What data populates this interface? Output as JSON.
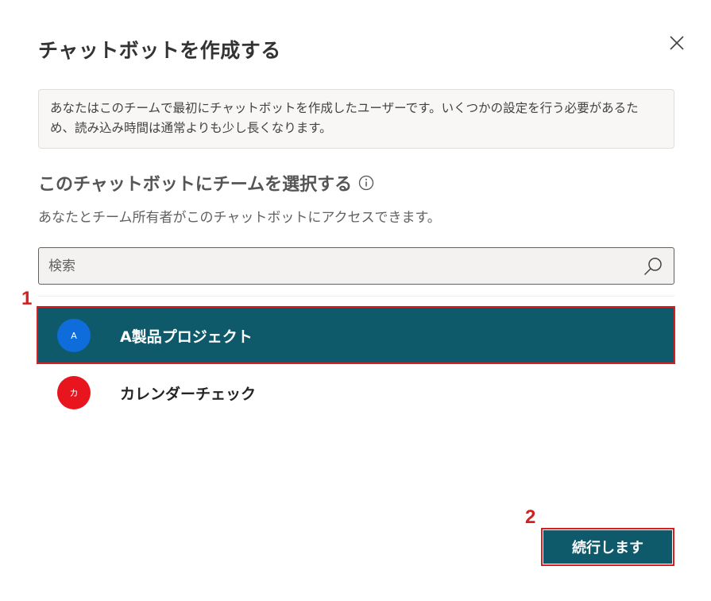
{
  "dialog": {
    "title": "チャットボットを作成する",
    "notice": "あなたはこのチームで最初にチャットボットを作成したユーザーです。いくつかの設定を行う必要があるため、読み込み時間は通常よりも少し長くなります。",
    "section_title": "このチャットボットにチームを選択する",
    "subtitle": "あなたとチーム所有者がこのチャットボットにアクセスできます。",
    "search": {
      "placeholder": "検索",
      "value": ""
    },
    "teams": [
      {
        "label": "A製品プロジェクト",
        "initial": "A",
        "color": "#0f6cdb",
        "selected": true
      },
      {
        "label": "カレンダーチェック",
        "initial": "カ",
        "color": "#e8141e",
        "selected": false
      }
    ],
    "continue_label": "続行します"
  },
  "annotations": {
    "step1": "1",
    "step2": "2",
    "color": "#d42020"
  },
  "icons": [
    "close-icon",
    "info-icon",
    "search-icon"
  ]
}
